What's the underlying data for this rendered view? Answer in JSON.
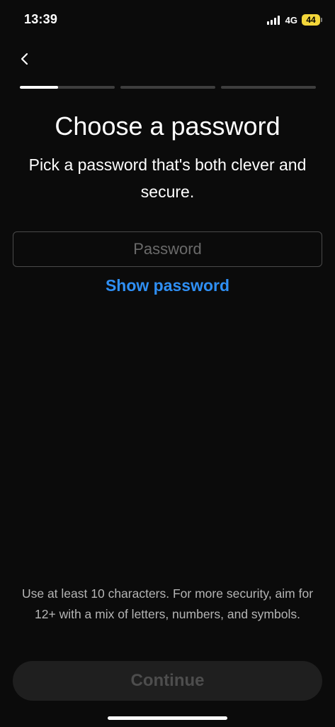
{
  "status_bar": {
    "time": "13:39",
    "network": "4G",
    "battery_level": "44",
    "icons": [
      "signal-icon",
      "battery-icon"
    ]
  },
  "navigation": {
    "back_icon": "chevron-left-icon"
  },
  "progress": {
    "total_steps": 3,
    "current_step": 1,
    "current_step_fill": 0.4
  },
  "header": {
    "title": "Choose a password",
    "subtitle": "Pick a password that's both clever and secure."
  },
  "form": {
    "password": {
      "value": "",
      "placeholder": "Password"
    },
    "show_password_label": "Show password",
    "hint": "Use at least 10 characters. For more security, aim for 12+ with a mix of letters, numbers, and symbols.",
    "continue_label": "Continue"
  },
  "colors": {
    "background": "#0b0b0b",
    "accent_link": "#2f8ff4",
    "battery": "#f3d63a",
    "button_disabled_bg": "#1f1f1f",
    "button_disabled_text": "#4d4d4d"
  }
}
